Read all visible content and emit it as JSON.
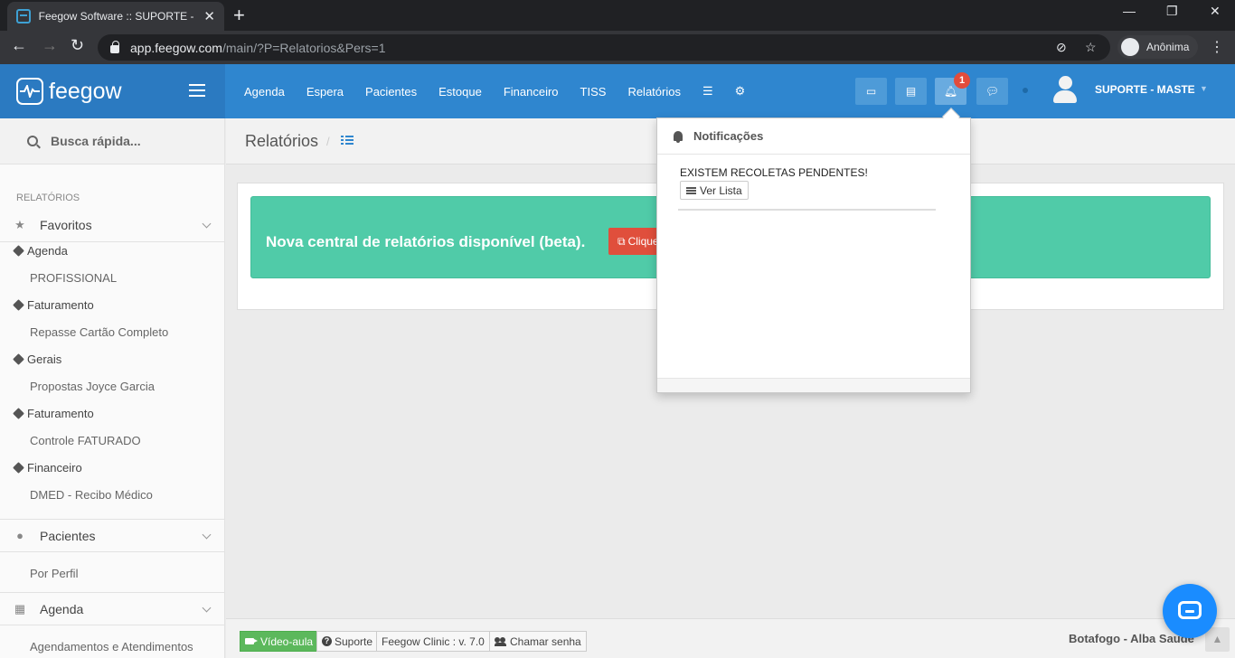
{
  "browser": {
    "tab_title": "Feegow Software :: SUPORTE - M",
    "new_tab": "+",
    "url_host": "app.feegow.com",
    "url_path": "/main/?P=Relatorios&Pers=1",
    "profile_label": "Anônima"
  },
  "header": {
    "brand": "feegow",
    "nav": [
      "Agenda",
      "Espera",
      "Pacientes",
      "Estoque",
      "Financeiro",
      "TISS",
      "Relatórios"
    ],
    "notification_count": "1",
    "user_name": "SUPORTE - MASTE",
    "brand_color": "#2f86cf"
  },
  "sidebar": {
    "search_label": "Busca rápida...",
    "section_heading": "RELATÓRIOS",
    "favorites_label": "Favoritos",
    "favorites": [
      {
        "category": "Agenda",
        "report": "PROFISSIONAL"
      },
      {
        "category": "Faturamento",
        "report": "Repasse Cartão Completo"
      },
      {
        "category": "Gerais",
        "report": "Propostas Joyce Garcia"
      },
      {
        "category": "Faturamento",
        "report": "Controle FATURADO"
      },
      {
        "category": "Financeiro",
        "report": "DMED - Recibo Médico"
      }
    ],
    "pacientes_label": "Pacientes",
    "pacientes_items": [
      "Por Perfil"
    ],
    "agenda_label": "Agenda",
    "agenda_items": [
      "Agendamentos e Atendimentos"
    ]
  },
  "page": {
    "title": "Relatórios",
    "breadcrumb_sep": "/",
    "alert_text": "Nova central de relatórios disponível (beta).",
    "alert_button": "Clique",
    "alert_color": "#50cba8"
  },
  "notifications": {
    "title": "Notificações",
    "message": "EXISTEM RECOLETAS PENDENTES!",
    "button": "Ver Lista"
  },
  "footer": {
    "video_label": "Vídeo-aula",
    "support_label": "Suporte",
    "version_label": "Feegow Clinic : v. 7.0",
    "call_label": "Chamar senha",
    "clinic_name": "Botafogo - Alba Saude"
  }
}
